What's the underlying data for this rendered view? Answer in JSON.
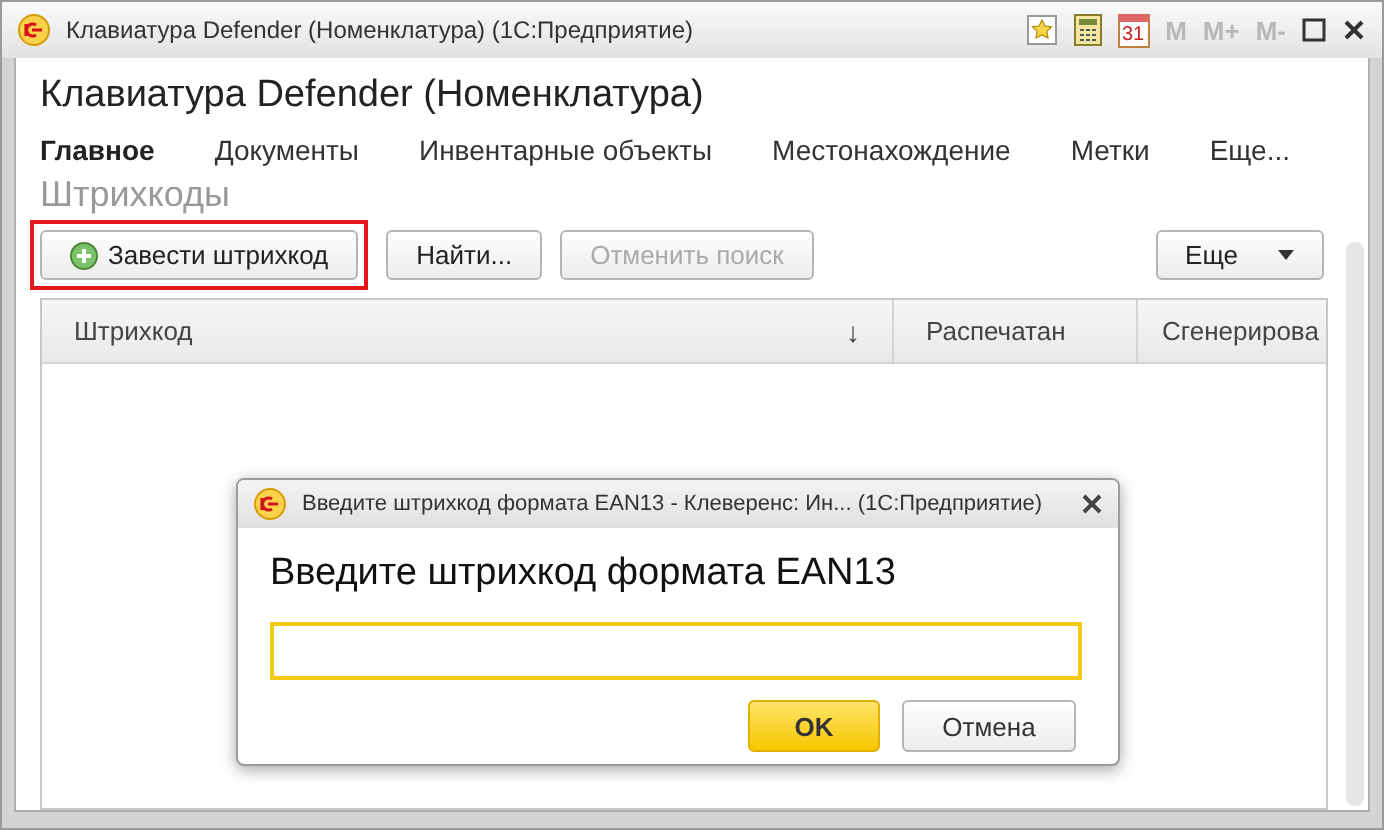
{
  "window": {
    "title": "Клавиатура Defender (Номенклатура)  (1С:Предприятие)",
    "calendar_day": "31",
    "memory_keys": [
      "M",
      "M+",
      "M-"
    ]
  },
  "heading": "Клавиатура Defender (Номенклатура)",
  "tabs": [
    {
      "label": "Главное",
      "selected": true
    },
    {
      "label": "Документы",
      "selected": false
    },
    {
      "label": "Инвентарные объекты",
      "selected": false
    },
    {
      "label": "Местонахождение",
      "selected": false
    },
    {
      "label": "Метки",
      "selected": false
    },
    {
      "label": "Еще...",
      "selected": false
    }
  ],
  "section_title": "Штрихкоды",
  "toolbar": [
    {
      "label": "Завести штрихкод",
      "kind": "add",
      "highlighted": true,
      "disabled": false
    },
    {
      "label": "Найти...",
      "kind": "plain",
      "highlighted": false,
      "disabled": false
    },
    {
      "label": "Отменить поиск",
      "kind": "plain",
      "highlighted": false,
      "disabled": true
    }
  ],
  "more_button": "Еще",
  "table": {
    "columns": [
      {
        "label": "Штрихкод",
        "sort": "↓"
      },
      {
        "label": "Распечатан"
      },
      {
        "label": "Сгенерирова"
      }
    ]
  },
  "dialog": {
    "title": "Введите штрихкод формата EAN13 - Клеверенс: Ин...  (1С:Предприятие)",
    "prompt": "Введите штрихкод формата EAN13",
    "buttons": [
      {
        "label": "OK",
        "default": true
      },
      {
        "label": "Отмена",
        "default": false
      }
    ]
  }
}
